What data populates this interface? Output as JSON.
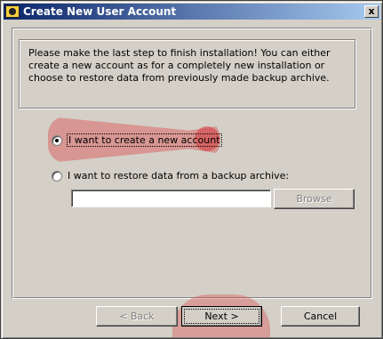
{
  "window": {
    "title": "Create New User Account",
    "close_label": "x"
  },
  "info": {
    "text": "Please make the last step to finish installation! You can either create a new account as for a completely new installation or choose to restore data from previously made backup archive."
  },
  "options": {
    "create_label": "I want to create a new account",
    "restore_label": "I want to restore data from a backup archive:",
    "selected": "create"
  },
  "backup_path": {
    "value": ""
  },
  "buttons": {
    "browse_label": "Browse",
    "back_label": "< Back",
    "next_label": "Next >",
    "cancel_label": "Cancel"
  }
}
